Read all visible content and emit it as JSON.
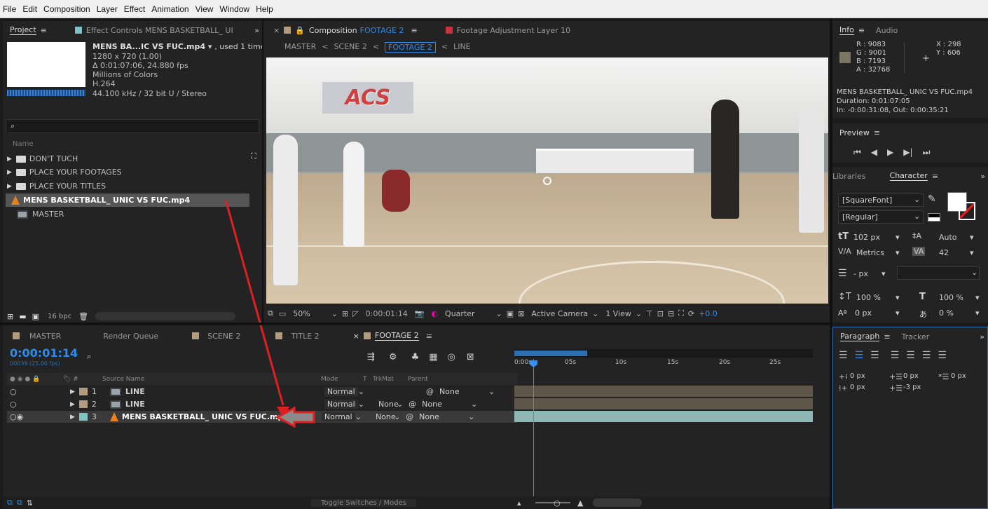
{
  "menu": [
    "File",
    "Edit",
    "Composition",
    "Layer",
    "Effect",
    "Animation",
    "View",
    "Window",
    "Help"
  ],
  "project_panel": {
    "tab_project": "Project",
    "tab_effect_controls": "Effect Controls MENS BASKETBALL_ UI",
    "asset_name": "MENS BA...IC VS FUC.mp4",
    "asset_used": ", used 1 time",
    "asset_res": "1280 x 720 (1.00)",
    "asset_duration": "Δ 0:01:07:06, 24.880 fps",
    "asset_colors": "Millions of Colors",
    "asset_codec": "H.264",
    "asset_audio": "44.100 kHz / 32 bit U / Stereo",
    "search_placeholder": "",
    "column_name": "Name",
    "items": [
      {
        "label": "DON'T TUCH",
        "type": "folder"
      },
      {
        "label": "PLACE YOUR FOOTAGES",
        "type": "folder"
      },
      {
        "label": "PLACE YOUR TITLES",
        "type": "folder"
      },
      {
        "label": "MENS BASKETBALL_ UNIC VS FUC.mp4",
        "type": "footage"
      },
      {
        "label": "MASTER",
        "type": "comp"
      }
    ],
    "bpc": "16 bpc"
  },
  "comp_panel": {
    "tab_comp_prefix": "Composition",
    "tab_comp_name": "FOOTAGE 2",
    "tab_footage": "Footage Adjustment Layer 10",
    "breadcrumbs": [
      "MASTER",
      "SCENE 2",
      "FOOTAGE 2",
      "LINE"
    ],
    "banner_text": "ACS",
    "zoom": "50%",
    "timecode": "0:00:01:14",
    "resolution": "Quarter",
    "camera": "Active Camera",
    "views": "1 View",
    "exposure": "+0.0"
  },
  "timeline": {
    "tabs": [
      "MASTER",
      "Render Queue",
      "SCENE 2",
      "TITLE 2",
      "FOOTAGE 2"
    ],
    "timecode": "0:00:01:14",
    "frame_info": "00039 (25.00 fps)",
    "headers": {
      "source": "Source Name",
      "mode": "Mode",
      "t": "T",
      "trkmat": "TrkMat",
      "parent": "Parent"
    },
    "ruler": [
      "0:00s",
      "05s",
      "10s",
      "15s",
      "20s",
      "25s"
    ],
    "layers": [
      {
        "num": "1",
        "name": "LINE",
        "mode": "Normal",
        "trkmat": "",
        "parent": "None"
      },
      {
        "num": "2",
        "name": "LINE",
        "mode": "Normal",
        "trkmat": "None",
        "parent": "None"
      },
      {
        "num": "3",
        "name": "MENS BASKETBALL_ UNIC VS FUC.mp4",
        "mode": "Normal",
        "trkmat": "None",
        "parent": "None"
      }
    ],
    "toggle_label": "Toggle Switches / Modes"
  },
  "info_panel": {
    "tab_info": "Info",
    "tab_audio": "Audio",
    "r": "R : 9083",
    "g": "G : 9001",
    "b": "B : 7193",
    "a": "A : 32768",
    "x": "X : 298",
    "y": "Y : 606",
    "clip_name": "MENS BASKETBALL_ UNIC VS FUC.mp4",
    "clip_duration": "Duration: 0:01:07:05",
    "clip_inout": "In: -0:00:31:08, Out: 0:00:35:21"
  },
  "preview_panel": {
    "tab": "Preview"
  },
  "character_panel": {
    "tab_libraries": "Libraries",
    "tab_character": "Character",
    "font": "[SquareFont]",
    "style": "[Regular]",
    "font_size": "102 px",
    "leading": "Auto",
    "kerning": "Metrics",
    "tracking": "42",
    "stroke": "- px",
    "vscale": "100 %",
    "hscale": "100 %",
    "baseline": "0 px",
    "tsume": "0 %"
  },
  "paragraph_panel": {
    "tab_paragraph": "Paragraph",
    "tab_tracker": "Tracker",
    "indent_left": "0 px",
    "indent_first": "0 px",
    "indent_right": "0 px",
    "space_before": "0 px",
    "space_after": "-3 px"
  },
  "colors": {
    "accent": "#2d8ceb",
    "annotation": "#e02020",
    "label_tan": "#b39b7d",
    "label_red": "#c8323a"
  }
}
